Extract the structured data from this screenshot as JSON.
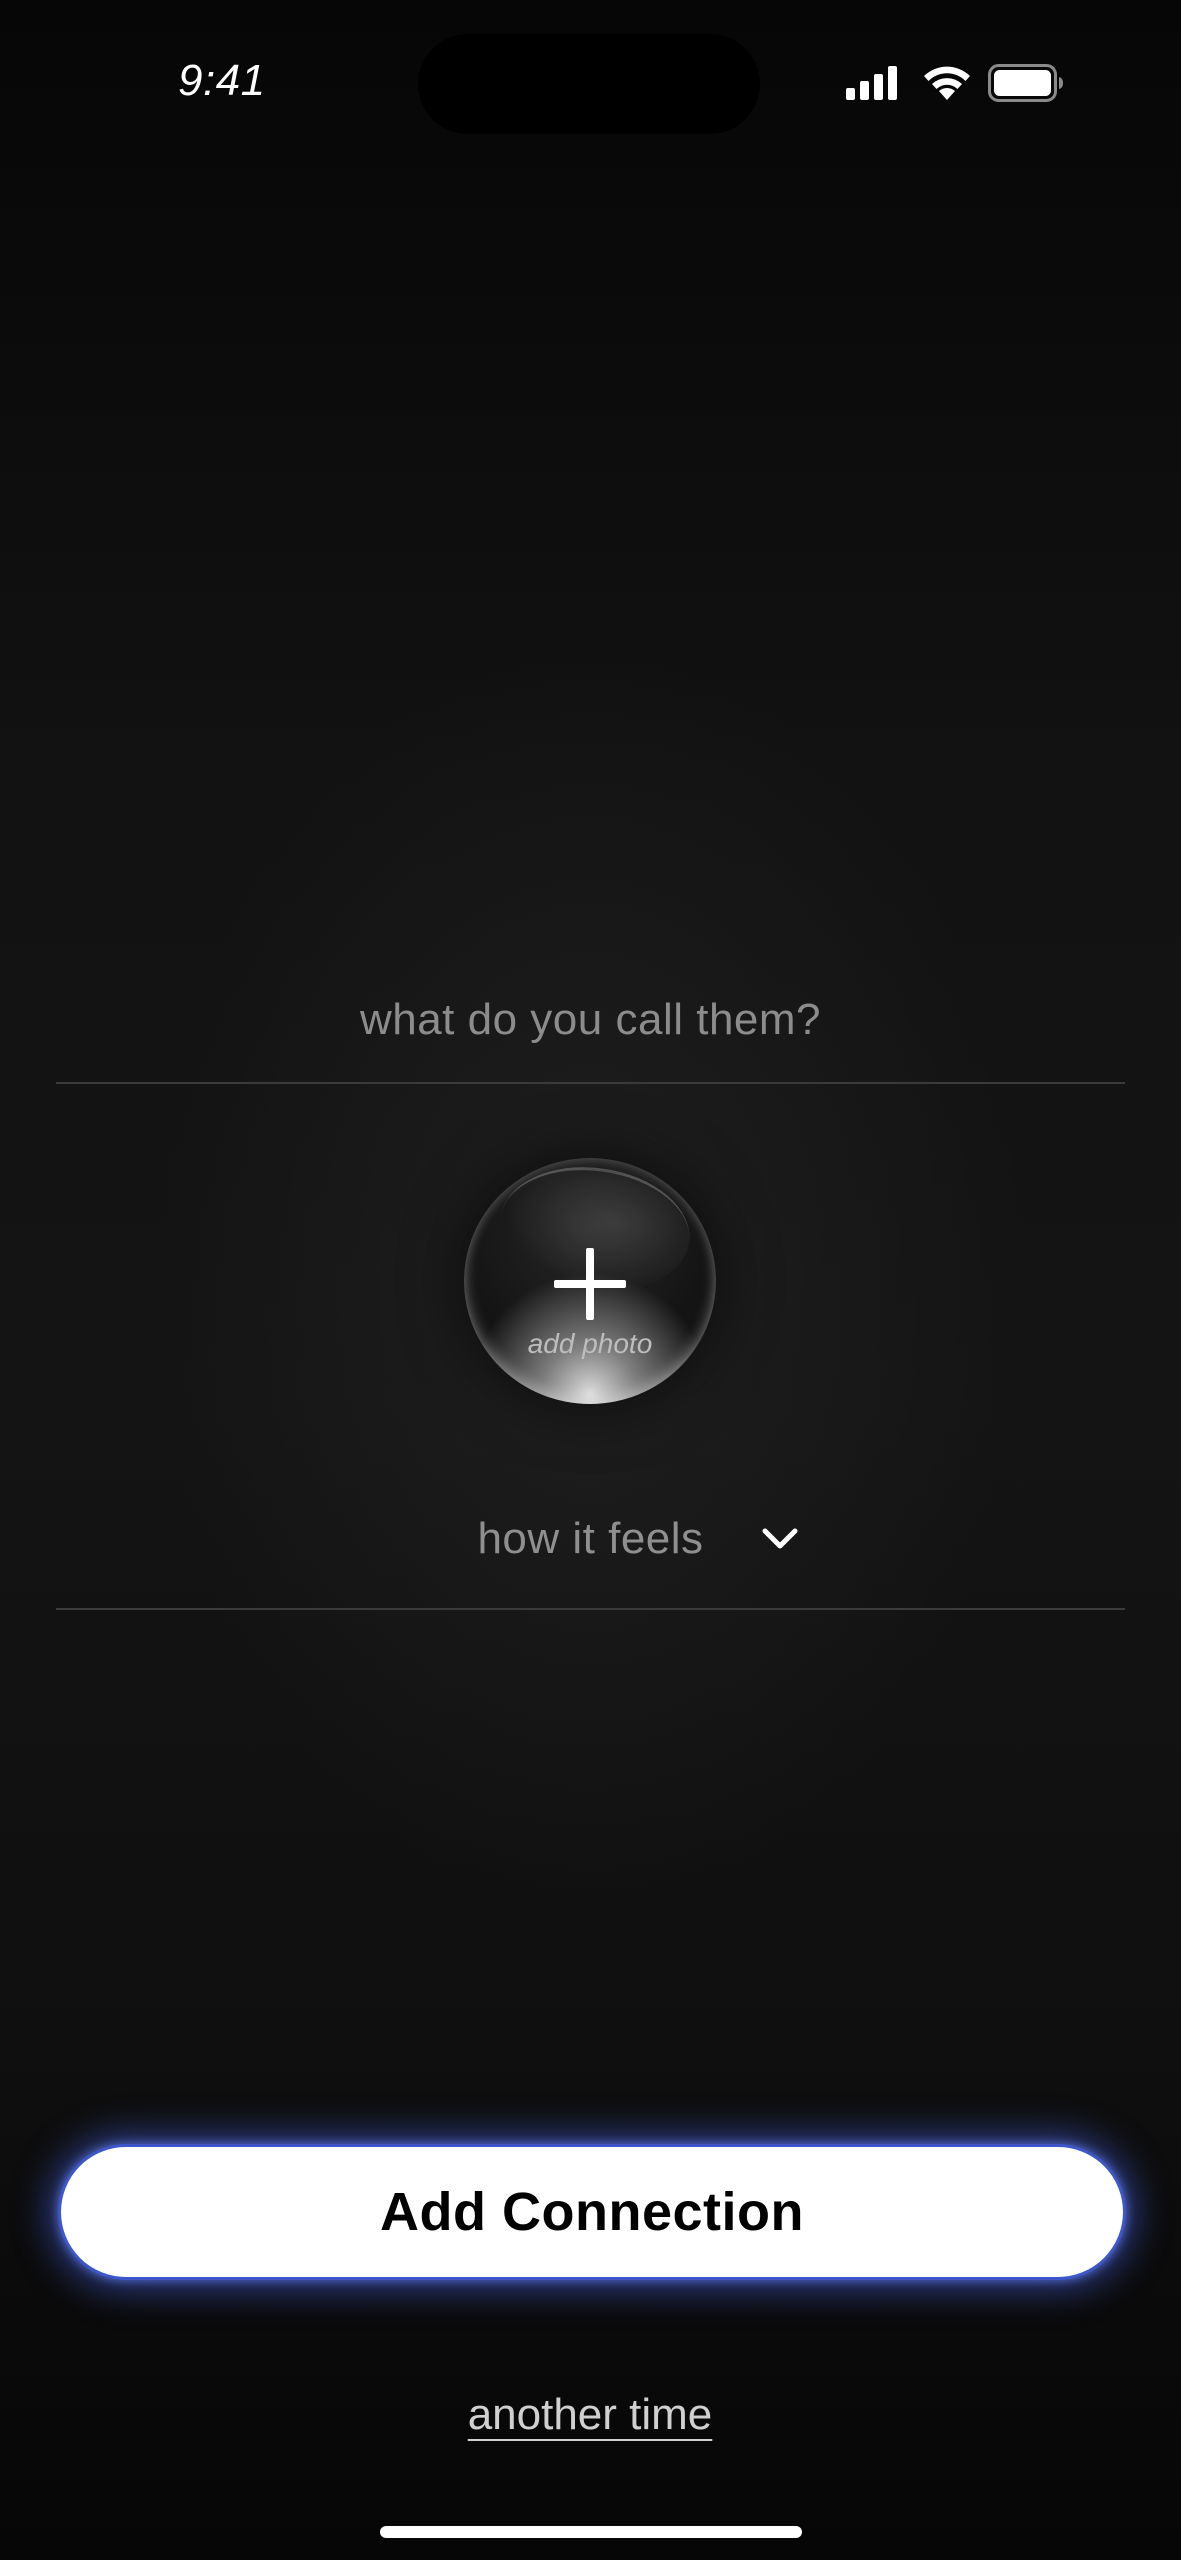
{
  "status_bar": {
    "time": "9:41",
    "icons": [
      "signal-icon",
      "wifi-icon",
      "battery-icon"
    ]
  },
  "form": {
    "name_placeholder": "what do you call them?",
    "name_value": "",
    "photo": {
      "icon": "plus-icon",
      "label": "add photo"
    },
    "feeling": {
      "placeholder": "how it feels",
      "icon": "chevron-down-icon"
    }
  },
  "actions": {
    "primary_label": "Add Connection",
    "secondary_label": "another time"
  },
  "colors": {
    "background": "#0b0b0b",
    "button_background": "#ffffff",
    "button_glow": "#4e6eff",
    "button_border": "#3d56c9",
    "placeholder_text": "#8c8c8c"
  }
}
